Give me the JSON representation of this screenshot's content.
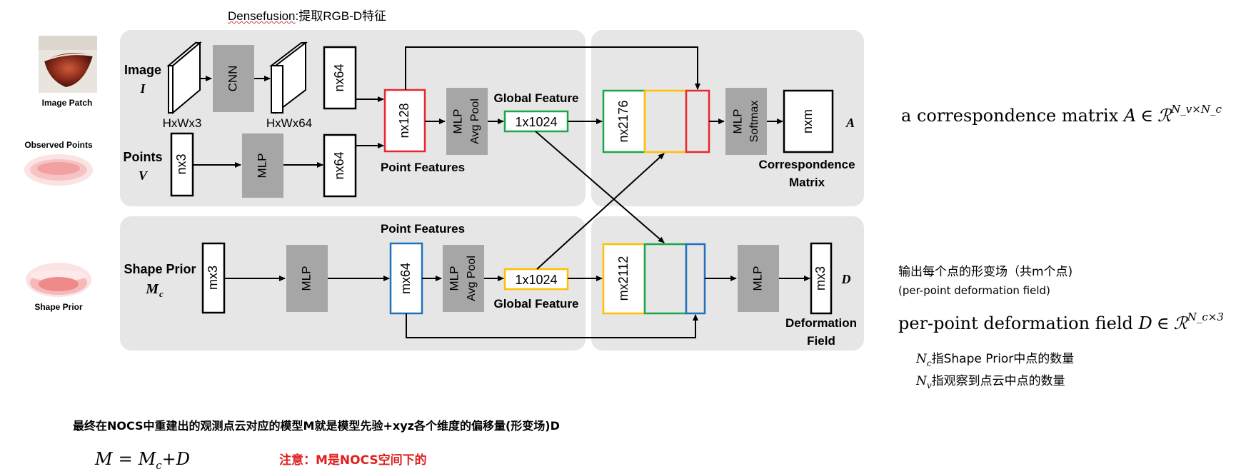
{
  "top_title": {
    "prefix": "Densefusion",
    "suffix": ":提取RGB-D特征"
  },
  "inputs": {
    "image_patch_label": "Image Patch",
    "observed_points_label": "Observed Points",
    "shape_prior_label": "Shape Prior"
  },
  "row1": {
    "image_label": "Image",
    "image_symbol": "I",
    "points_label": "Points",
    "points_symbol": "V",
    "hxwx3": "HxWx3",
    "cnn": "CNN",
    "hxwx64": "HxWx64",
    "nx64_top": "nx64",
    "nx3": "nx3",
    "mlp_points": "MLP",
    "nx64_bottom": "nx64",
    "point_features": "Point Features",
    "nx128": "nx128",
    "mlp": "MLP",
    "avg_pool": "Avg Pool",
    "global_feature": "Global Feature",
    "gf_value": "1x1024",
    "nx2176": "nx2176",
    "softmax": "Softmax",
    "nxm": "nxm",
    "out_symbol": "A",
    "out_label_1": "Correspondence",
    "out_label_2": "Matrix"
  },
  "row2": {
    "point_features": "Point Features",
    "shape_prior_label": "Shape Prior",
    "shape_prior_symbol": "M",
    "shape_prior_sub": "c",
    "mx3": "mx3",
    "mlp1": "MLP",
    "mx64": "mx64",
    "mlp2": "MLP",
    "avg_pool": "Avg Pool",
    "gf_value": "1x1024",
    "global_feature": "Global Feature",
    "mx2112": "mx2112",
    "mlp3": "MLP",
    "mx3_out": "mx3",
    "out_symbol": "D",
    "out_label_1": "Deformation",
    "out_label_2": "Field"
  },
  "annotations": {
    "corr_text": "a correspondence matrix ",
    "corr_A": "A",
    "corr_in": "∈",
    "corr_R": "ℛ",
    "corr_exp": "N_v×N_c",
    "cn_output": "输出每个点的形变场（共m个点)",
    "per_point_en": "(per-point deformation field)",
    "deform_text": "per-point deformation field ",
    "deform_D": "D",
    "deform_in": "∈",
    "deform_R": "ℛ",
    "deform_exp": "N_c×3",
    "nc_sym": "N",
    "nc_sub": "c",
    "nc_desc": "指Shape Prior中点的数量",
    "nv_sym": "N",
    "nv_sub": "v",
    "nv_desc": "指观察到点云中点的数量",
    "bottom_cn": "最终在NOCS中重建出的观测点云对应的模型M就是模型先验+xyz各个维度的偏移量(形变场)D",
    "formula_M": "M",
    "formula_eq": "=",
    "formula_Mc": "M",
    "formula_c": "c",
    "formula_plus": "+D",
    "note_red": "注意：M是NOCS空间下的"
  },
  "colors": {
    "panel": "#e6e6e6",
    "mlp_box": "#a6a6a6",
    "red": "#e8262c",
    "green": "#1aa74a",
    "yellow": "#ffc000",
    "blue": "#2070c0",
    "note_red": "#e02020"
  }
}
